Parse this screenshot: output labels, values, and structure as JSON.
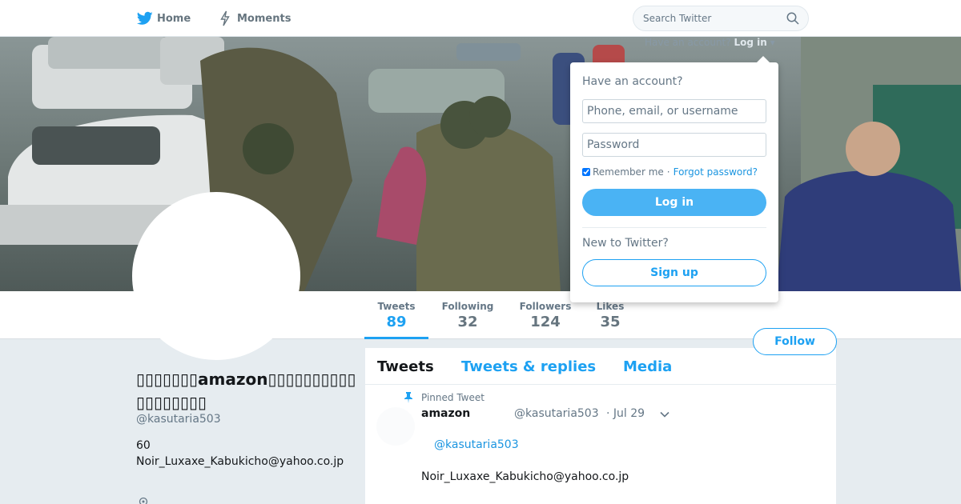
{
  "nav": {
    "home_label": "Home",
    "home_icon": "twitter-bird-icon",
    "moments_label": "Moments",
    "moments_icon": "lightning-icon",
    "search_placeholder": "Search Twitter",
    "search_icon": "search-icon"
  },
  "login_prompt": {
    "have_account": "Have an account?",
    "login_link": "Log in"
  },
  "login_dropdown": {
    "title": "Have an account?",
    "username_placeholder": "Phone, email, or username",
    "password_placeholder": "Password",
    "remember_label": "Remember me",
    "separator": "·",
    "forgot_label": "Forgot password?",
    "login_button": "Log in",
    "new_label": "New to Twitter?",
    "signup_button": "Sign up"
  },
  "stats": {
    "tweets_label": "Tweets",
    "tweets_value": "89",
    "following_label": "Following",
    "following_value": "32",
    "followers_label": "Followers",
    "followers_value": "124",
    "likes_label": "Likes",
    "likes_value": "35"
  },
  "follow_button": "Follow",
  "profile": {
    "name": "▯▯▯▯▯▯▯amazon▯▯▯▯▯▯▯▯▯▯▯▯▯▯▯▯▯▯",
    "handle": "@kasutaria503",
    "bio_line1": "60",
    "bio_line2": "Noir_Luxaxe_Kabukicho@yahoo.co.jp",
    "location_icon": "location-pin-icon"
  },
  "tabs": {
    "tweets": "Tweets",
    "replies": "Tweets & replies",
    "media": "Media"
  },
  "pinned_tweet": {
    "pinned_label": "Pinned Tweet",
    "pin_icon": "pin-icon",
    "name": "amazon",
    "handle": "@kasutaria503",
    "time": "· Jul 29",
    "mention": "@kasutaria503",
    "text": "Noir_Luxaxe_Kabukicho@yahoo.co.jp"
  },
  "colors": {
    "accent": "#1da1f2",
    "background": "#e6ecf0",
    "text": "#14171a",
    "muted": "#657786"
  }
}
